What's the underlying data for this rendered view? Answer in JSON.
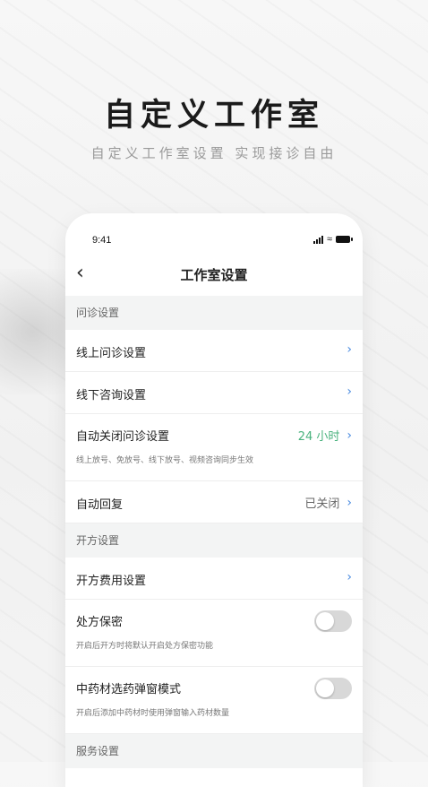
{
  "hero": {
    "title": "自定义工作室",
    "subtitle": "自定义工作室设置 实现接诊自由"
  },
  "status_bar": {
    "time": "9:41"
  },
  "nav": {
    "title": "工作室设置"
  },
  "sections": {
    "consult": {
      "header": "问诊设置"
    },
    "prescribe": {
      "header": "开方设置"
    },
    "service": {
      "header": "服务设置"
    }
  },
  "rows": {
    "online_consult": {
      "label": "线上问诊设置"
    },
    "offline_consult": {
      "label": "线下咨询设置"
    },
    "auto_close": {
      "label": "自动关闭问诊设置",
      "value": "24 小时",
      "desc": "线上放号、免放号、线下放号、视频咨询同步生效"
    },
    "auto_reply": {
      "label": "自动回复",
      "value": "已关闭"
    },
    "prescribe_fee": {
      "label": "开方费用设置"
    },
    "prescription_private": {
      "label": "处方保密",
      "desc": "开启后开方时将默认开启处方保密功能",
      "enabled": false
    },
    "herb_popup": {
      "label": "中药材选药弹窗模式",
      "desc": "开启后添加中药材时使用弹窗输入药材数量",
      "enabled": false
    }
  },
  "colors": {
    "accent_green": "#49b27d",
    "chevron_blue": "#4a8be0",
    "section_bg": "#f3f4f4"
  }
}
